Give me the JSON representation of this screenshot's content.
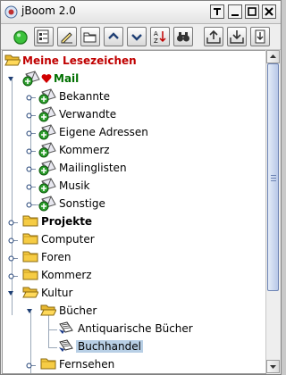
{
  "window": {
    "title": "jBoom 2.0"
  },
  "toolbar": {
    "buttons": [
      "status-icon",
      "properties-icon",
      "edit-icon",
      "open-folder-icon",
      "move-up-icon",
      "move-down-icon",
      "sort-az-icon",
      "find-icon",
      "export-icon",
      "import-icon",
      "extract-icon"
    ]
  },
  "tree": {
    "root": "Meine Lesezeichen",
    "mail": "Mail",
    "mail_children": [
      "Bekannte",
      "Verwandte",
      "Eigene Adressen",
      "Kommerz",
      "Mailinglisten",
      "Musik",
      "Sonstige"
    ],
    "projekte": "Projekte",
    "computer": "Computer",
    "foren": "Foren",
    "kommerz": "Kommerz",
    "kultur": "Kultur",
    "buecher": "Bücher",
    "antiquarische": "Antiquarische Bücher",
    "buchhandel": "Buchhandel",
    "fernsehen": "Fernsehen"
  },
  "colors": {
    "root_label": "#c00000",
    "mail_label": "#007000",
    "selection": "#b8cfe5",
    "folder": "#f4c430"
  }
}
